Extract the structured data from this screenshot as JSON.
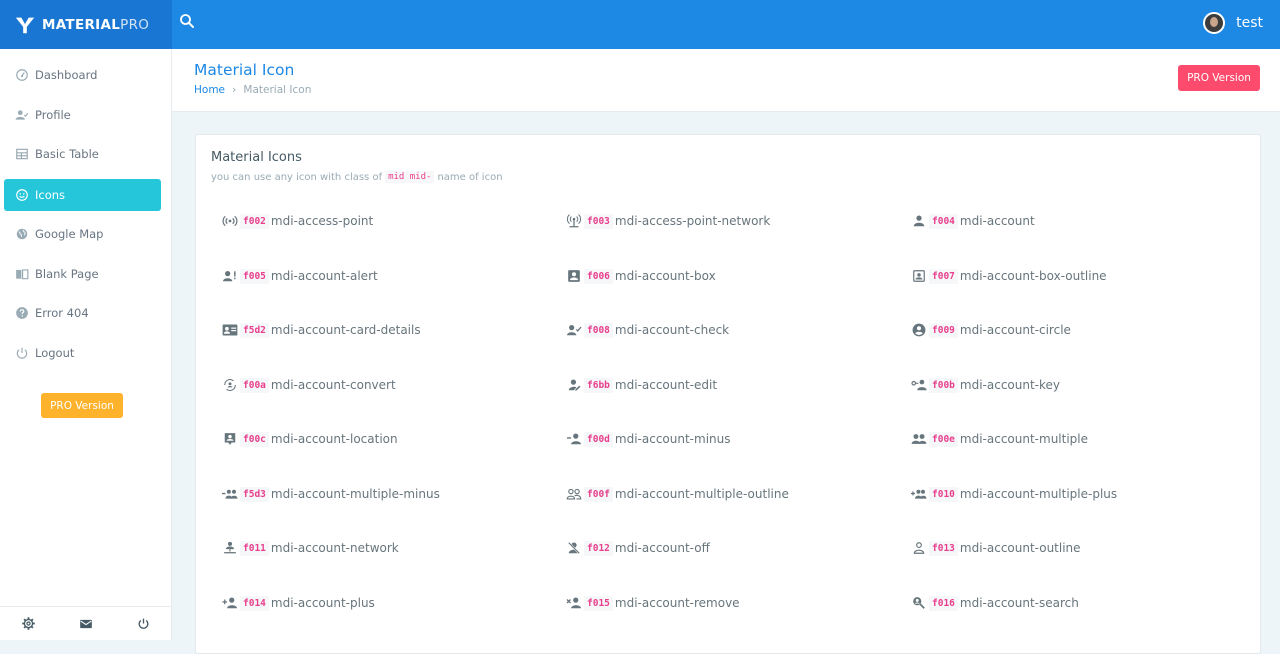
{
  "app": {
    "brand_main": "MATERIAL",
    "brand_accent": "PRO",
    "user_name": "test"
  },
  "sidebar": {
    "items": [
      {
        "label": "Dashboard",
        "icon": "gauge-icon"
      },
      {
        "label": "Profile",
        "icon": "account-check-icon"
      },
      {
        "label": "Basic Table",
        "icon": "table-icon"
      },
      {
        "label": "Icons",
        "icon": "emoticon-icon",
        "active": true
      },
      {
        "label": "Google Map",
        "icon": "earth-icon"
      },
      {
        "label": "Blank Page",
        "icon": "book-open-icon"
      },
      {
        "label": "Error 404",
        "icon": "help-circle-icon"
      },
      {
        "label": "Logout",
        "icon": "power-icon"
      }
    ],
    "pro_label": "PRO Version",
    "footer_icons": [
      "settings-icon",
      "mail-icon",
      "power-icon"
    ]
  },
  "header": {
    "title": "Material Icon",
    "breadcrumb": [
      "Home",
      "Material Icon"
    ],
    "pro_label": "PRO Version"
  },
  "card": {
    "title": "Material Icons",
    "subtitle_before": "you can use any icon with class of",
    "subtitle_code": "mid mid-",
    "subtitle_after": "name of icon"
  },
  "icons": [
    {
      "code": "f002",
      "name": "mdi-access-point"
    },
    {
      "code": "f003",
      "name": "mdi-access-point-network"
    },
    {
      "code": "f004",
      "name": "mdi-account"
    },
    {
      "code": "f005",
      "name": "mdi-account-alert"
    },
    {
      "code": "f006",
      "name": "mdi-account-box"
    },
    {
      "code": "f007",
      "name": "mdi-account-box-outline"
    },
    {
      "code": "f5d2",
      "name": "mdi-account-card-details"
    },
    {
      "code": "f008",
      "name": "mdi-account-check"
    },
    {
      "code": "f009",
      "name": "mdi-account-circle"
    },
    {
      "code": "f00a",
      "name": "mdi-account-convert"
    },
    {
      "code": "f6bb",
      "name": "mdi-account-edit"
    },
    {
      "code": "f00b",
      "name": "mdi-account-key"
    },
    {
      "code": "f00c",
      "name": "mdi-account-location"
    },
    {
      "code": "f00d",
      "name": "mdi-account-minus"
    },
    {
      "code": "f00e",
      "name": "mdi-account-multiple"
    },
    {
      "code": "f5d3",
      "name": "mdi-account-multiple-minus"
    },
    {
      "code": "f00f",
      "name": "mdi-account-multiple-outline"
    },
    {
      "code": "f010",
      "name": "mdi-account-multiple-plus"
    },
    {
      "code": "f011",
      "name": "mdi-account-network"
    },
    {
      "code": "f012",
      "name": "mdi-account-off"
    },
    {
      "code": "f013",
      "name": "mdi-account-outline"
    },
    {
      "code": "f014",
      "name": "mdi-account-plus"
    },
    {
      "code": "f015",
      "name": "mdi-account-remove"
    },
    {
      "code": "f016",
      "name": "mdi-account-search"
    }
  ],
  "colors": {
    "topbar": "#1e88e5",
    "brand_bg": "#1976d2",
    "active_nav": "#26c6da",
    "pro_red": "#fc4b6c",
    "pro_yellow": "#ffb22b",
    "code_pink": "#e83e8c"
  }
}
